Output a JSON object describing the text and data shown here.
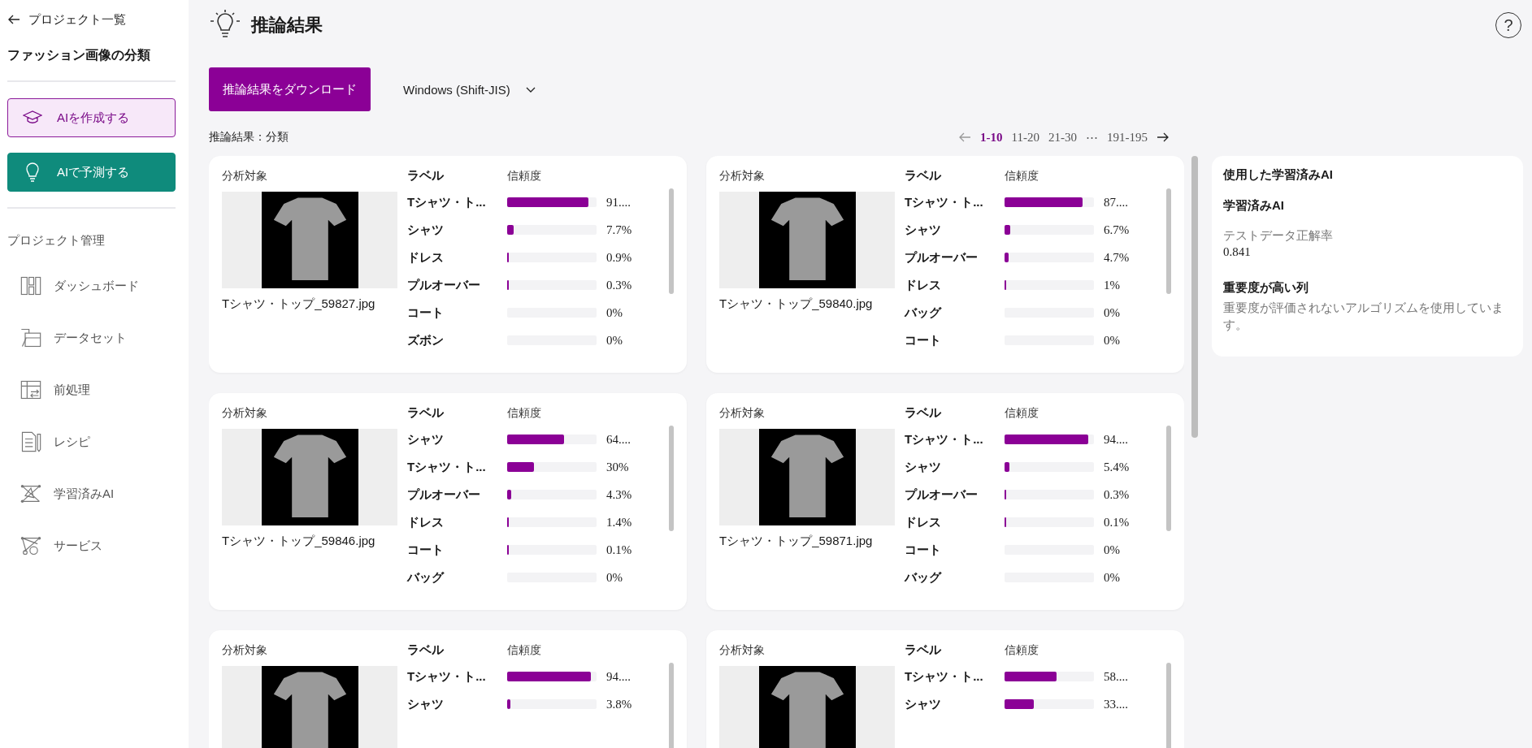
{
  "sidebar": {
    "back_link": "プロジェクト一覧",
    "project_title": "ファッション画像の分類",
    "actions": [
      {
        "label": "AIを作成する",
        "kind": "outline"
      },
      {
        "label": "AIで予測する",
        "kind": "filled"
      }
    ],
    "section_title": "プロジェクト管理",
    "nav": [
      {
        "label": "ダッシュボード"
      },
      {
        "label": "データセット"
      },
      {
        "label": "前処理"
      },
      {
        "label": "レシピ"
      },
      {
        "label": "学習済みAI"
      },
      {
        "label": "サービス"
      }
    ]
  },
  "header": {
    "title": "推論結果",
    "help": "?"
  },
  "toolbar": {
    "download_button": "推論結果をダウンロード",
    "encoding": "Windows (Shift-JIS)"
  },
  "results_label": "推論結果：分類",
  "pagination": {
    "prev_disabled": true,
    "next_disabled": false,
    "pages": [
      {
        "label": "1-10",
        "selected": true
      },
      {
        "label": "11-20",
        "selected": false
      },
      {
        "label": "21-30",
        "selected": false
      },
      {
        "label": "191-195",
        "selected": false
      }
    ],
    "ellipsis": "⋯"
  },
  "results": [
    {
      "target_heading": "分析対象",
      "label_heading": "ラベル",
      "confidence_heading": "信頼度",
      "filename": "Tシャツ・トップ_59827.jpg",
      "rows": [
        {
          "label": "Tシャツ・ト...",
          "level": 0.91,
          "reading": "91...."
        },
        {
          "label": "シャツ",
          "level": 0.077,
          "reading": "7.7%"
        },
        {
          "label": "ドレス",
          "level": 0.009,
          "reading": "0.9%"
        },
        {
          "label": "プルオーバー",
          "level": 0.003,
          "reading": "0.3%"
        },
        {
          "label": "コート",
          "level": 0,
          "reading": "0%"
        },
        {
          "label": "ズボン",
          "level": 0,
          "reading": "0%"
        }
      ]
    },
    {
      "target_heading": "分析対象",
      "label_heading": "ラベル",
      "confidence_heading": "信頼度",
      "filename": "Tシャツ・トップ_59840.jpg",
      "rows": [
        {
          "label": "Tシャツ・ト...",
          "level": 0.87,
          "reading": "87...."
        },
        {
          "label": "シャツ",
          "level": 0.067,
          "reading": "6.7%"
        },
        {
          "label": "プルオーバー",
          "level": 0.047,
          "reading": "4.7%"
        },
        {
          "label": "ドレス",
          "level": 0.01,
          "reading": "1%"
        },
        {
          "label": "バッグ",
          "level": 0,
          "reading": "0%"
        },
        {
          "label": "コート",
          "level": 0,
          "reading": "0%"
        }
      ]
    },
    {
      "target_heading": "分析対象",
      "label_heading": "ラベル",
      "confidence_heading": "信頼度",
      "filename": "Tシャツ・トップ_59846.jpg",
      "rows": [
        {
          "label": "シャツ",
          "level": 0.64,
          "reading": "64...."
        },
        {
          "label": "Tシャツ・ト...",
          "level": 0.3,
          "reading": "30%"
        },
        {
          "label": "プルオーバー",
          "level": 0.043,
          "reading": "4.3%"
        },
        {
          "label": "ドレス",
          "level": 0.014,
          "reading": "1.4%"
        },
        {
          "label": "コート",
          "level": 0.001,
          "reading": "0.1%"
        },
        {
          "label": "バッグ",
          "level": 0,
          "reading": "0%"
        }
      ]
    },
    {
      "target_heading": "分析対象",
      "label_heading": "ラベル",
      "confidence_heading": "信頼度",
      "filename": "Tシャツ・トップ_59871.jpg",
      "rows": [
        {
          "label": "Tシャツ・ト...",
          "level": 0.94,
          "reading": "94...."
        },
        {
          "label": "シャツ",
          "level": 0.054,
          "reading": "5.4%"
        },
        {
          "label": "プルオーバー",
          "level": 0.003,
          "reading": "0.3%"
        },
        {
          "label": "ドレス",
          "level": 0.001,
          "reading": "0.1%"
        },
        {
          "label": "コート",
          "level": 0,
          "reading": "0%"
        },
        {
          "label": "バッグ",
          "level": 0,
          "reading": "0%"
        }
      ]
    },
    {
      "target_heading": "分析対象",
      "label_heading": "ラベル",
      "confidence_heading": "信頼度",
      "rows": [
        {
          "label": "Tシャツ・ト...",
          "level": 0.94,
          "reading": "94...."
        },
        {
          "label": "シャツ",
          "level": 0.038,
          "reading": "3.8%"
        }
      ]
    },
    {
      "target_heading": "分析対象",
      "label_heading": "ラベル",
      "confidence_heading": "信頼度",
      "rows": [
        {
          "label": "Tシャツ・ト...",
          "level": 0.58,
          "reading": "58...."
        },
        {
          "label": "シャツ",
          "level": 0.33,
          "reading": "33...."
        }
      ]
    }
  ],
  "model_panel": {
    "title": "使用した学習済みAI",
    "model_name": "学習済みAI",
    "metric_label": "テストデータ正解率",
    "metric_value": "0.841",
    "importance_title": "重要度が高い列",
    "importance_text": "重要度が評価されないアルゴリズムを使用しています。"
  }
}
